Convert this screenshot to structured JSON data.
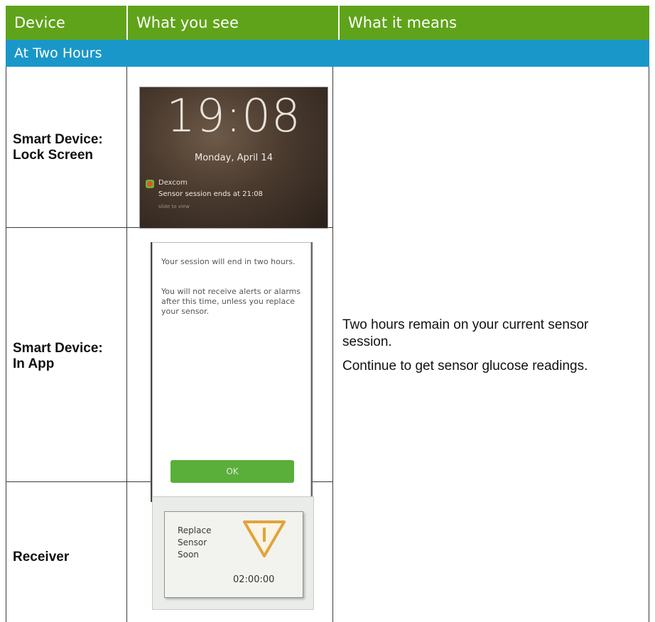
{
  "table": {
    "headers": [
      "Device",
      "What you see",
      "What it means"
    ],
    "section": "At Two Hours",
    "rows": [
      {
        "device": "Smart Device:\nLock Screen"
      },
      {
        "device": "Smart Device:\nIn App"
      },
      {
        "device": "Receiver"
      }
    ],
    "meaning": [
      "Two hours remain on your current sensor session.",
      "Continue to get sensor glucose readings."
    ]
  },
  "lock_screen": {
    "time": "19:08",
    "date": "Monday, April 14",
    "app_name": "Dexcom",
    "message": "Sensor session ends at 21:08",
    "hint": "slide to view"
  },
  "in_app": {
    "text1": "Your session will end in two hours.",
    "text2": "You will not receive alerts or alarms after this time, unless you replace your sensor.",
    "button": "OK"
  },
  "receiver": {
    "text": "Replace\nSensor\nSoon",
    "timer": "02:00:00",
    "icon": "warning-triangle-icon"
  },
  "colors": {
    "header_green": "#5fa31a",
    "section_blue": "#1a97c9",
    "ok_green": "#5aae3a",
    "warning_orange": "#e3a33a"
  }
}
